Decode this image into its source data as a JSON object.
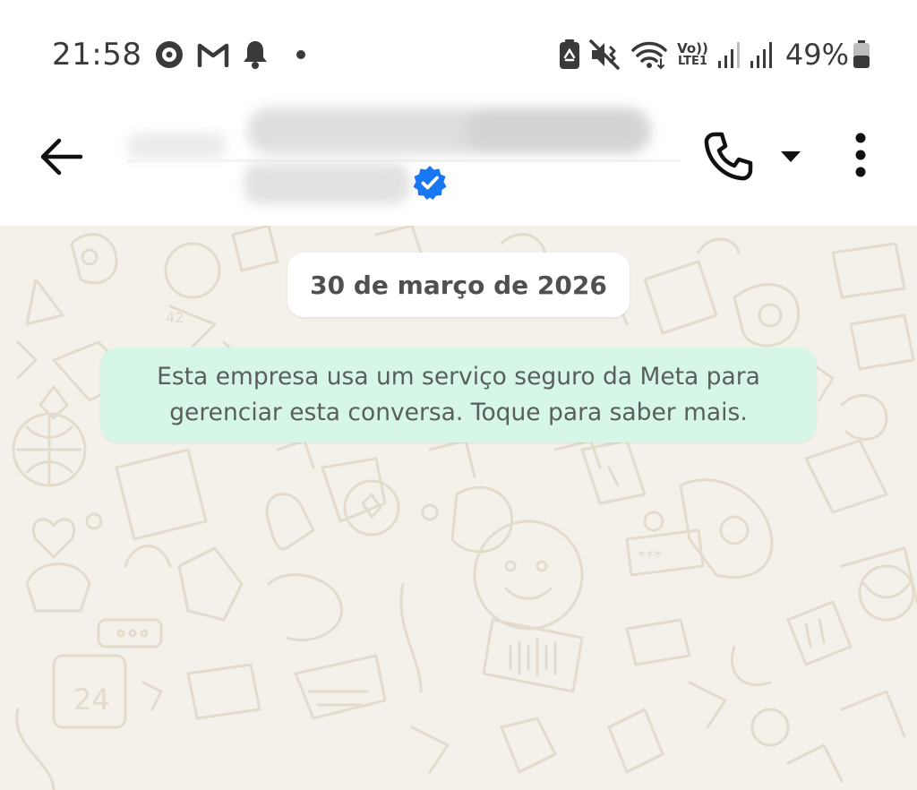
{
  "status_bar": {
    "time": "21:58",
    "battery_percent": "49%",
    "battery_level": 0.49,
    "left_icons": [
      "media-disc-icon",
      "gmail-icon",
      "bell-icon",
      "dot-icon"
    ],
    "right_icons": [
      "battery-saver-icon",
      "mute-vibrate-icon",
      "wifi-icon",
      "volte-icon",
      "signal-1-icon",
      "signal-2-icon",
      "battery-icon"
    ],
    "volte_label_top": "Vo))",
    "volte_label_bottom": "LTE1"
  },
  "header": {
    "back_icon": "arrow-left-icon",
    "contact_verified": true,
    "call_icon": "phone-icon",
    "call_dropdown_icon": "caret-down-icon",
    "menu_icon": "more-vertical-icon"
  },
  "chat": {
    "date_chip": "30 de março de 2026",
    "system_message_line1": "Esta empresa usa um serviço seguro da Meta para",
    "system_message_line2": "gerenciar esta conversa. Toque para saber mais."
  },
  "colors": {
    "chat_background": "#f4f0ea",
    "system_bubble": "#d6f7e8",
    "verified_badge": "#1877f2",
    "icon_dark": "#111111",
    "status_text": "#3a3a3a"
  }
}
